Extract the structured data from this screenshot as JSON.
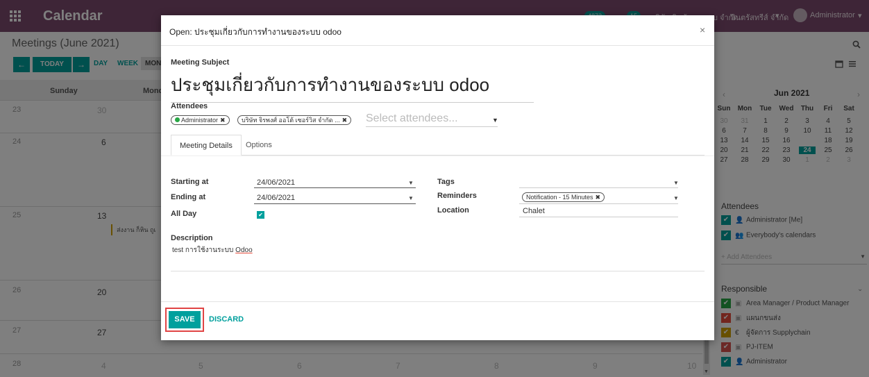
{
  "navbar": {
    "app_title": "Calendar",
    "badge_1": "4873",
    "badge_2": "15",
    "company_partial": "บริษัท สินค้า ทดสอบ จำกัด",
    "company": "อินตรัสทรีส์ จำกัด",
    "company_caret": "▾",
    "user": "Administrator",
    "user_caret": "▾"
  },
  "control_panel": {
    "title": "Meetings (June 2021)",
    "today_label": "TODAY",
    "prev_arrow": "←",
    "next_arrow": "→",
    "ranges": [
      "DAY",
      "WEEK",
      "MONTH"
    ],
    "search_icon": "search-icon",
    "view_icons": [
      "calendar-icon",
      "list-icon"
    ]
  },
  "calendar": {
    "day_headers": [
      "Sunday",
      "Monday"
    ],
    "weeks": [
      {
        "week": "23",
        "sun": "30",
        "sun_muted": true
      },
      {
        "week": "24",
        "sun": "6",
        "sun_muted": false
      },
      {
        "week": "25",
        "sun": "13",
        "sun_muted": false
      },
      {
        "week": "26",
        "sun": "20",
        "sun_muted": false
      },
      {
        "week": "27",
        "sun": "27",
        "sun_muted": false
      },
      {
        "week": "28",
        "sun": "4",
        "sun_muted": true
      }
    ],
    "bottom_row_days": [
      "5",
      "6",
      "7",
      "8",
      "9",
      "10"
    ],
    "event_label": "ส่งงาน ก็หิน ถูเ"
  },
  "mini_calendar": {
    "month": "Jun 2021",
    "prev": "‹",
    "next": "›",
    "dow": [
      "Sun",
      "Mon",
      "Tue",
      "Wed",
      "Thu",
      "Fri",
      "Sat"
    ],
    "weeks": [
      [
        "30",
        "31",
        "1",
        "2",
        "3",
        "4",
        "5"
      ],
      [
        "6",
        "7",
        "8",
        "9",
        "10",
        "11",
        "12"
      ],
      [
        "13",
        "14",
        "15",
        "16",
        "17",
        "18",
        "19"
      ],
      [
        "20",
        "21",
        "22",
        "23",
        "24",
        "25",
        "26"
      ],
      [
        "27",
        "28",
        "29",
        "30",
        "1",
        "2",
        "3"
      ]
    ],
    "today": "17",
    "selected": "24"
  },
  "sidebar": {
    "attendees_title": "Attendees",
    "attendees": [
      {
        "label": "Administrator [Me]",
        "color": "#00a09d"
      },
      {
        "label": "Everybody's calendars",
        "color": "#00a09d"
      }
    ],
    "add_attendees_placeholder": "+ Add Attendees",
    "responsible_title": "Responsible",
    "responsible": [
      {
        "label": "Area Manager / Product Manager",
        "color": "#28a745"
      },
      {
        "label": "แผนกขนส่ง",
        "color": "#e74c3c"
      },
      {
        "label": "ผู้จัดการ Supplychain",
        "color": "#d1a000"
      },
      {
        "label": "PJ-ITEM",
        "color": "#d9534f"
      },
      {
        "label": "Administrator",
        "color": "#00a09d"
      }
    ]
  },
  "modal": {
    "title": "Open: ประชุมเกี่ยวกับการทำงานของระบบ odoo",
    "close": "×",
    "subject_label": "Meeting Subject",
    "subject_value": "ประชุมเกี่ยวกับการทำงานของระบบ odoo",
    "attendees_label": "Attendees",
    "attendee_tags": [
      "Administrator",
      "บริษัท จิรพงศ์ ออโต้ เซอร์วิส จำกัด ..."
    ],
    "attendees_placeholder": "Select attendees...",
    "tabs": [
      "Meeting Details",
      "Options"
    ],
    "starting_at_label": "Starting at",
    "starting_at_value": "24/06/2021",
    "ending_at_label": "Ending at",
    "ending_at_value": "24/06/2021",
    "all_day_label": "All Day",
    "all_day_checked": true,
    "tags_label": "Tags",
    "reminders_label": "Reminders",
    "reminder_tag": "Notification - 15 Minutes",
    "location_label": "Location",
    "location_value": "Chalet",
    "description_label": "Description",
    "description_value": "test การใช้งานระบบ",
    "description_word": "Odoo",
    "save_label": "SAVE",
    "discard_label": "DISCARD"
  },
  "colors": {
    "navbar": "#7c4a6e",
    "primary": "#00a09d",
    "highlight": "#e04444",
    "today": "#e74c3c"
  }
}
